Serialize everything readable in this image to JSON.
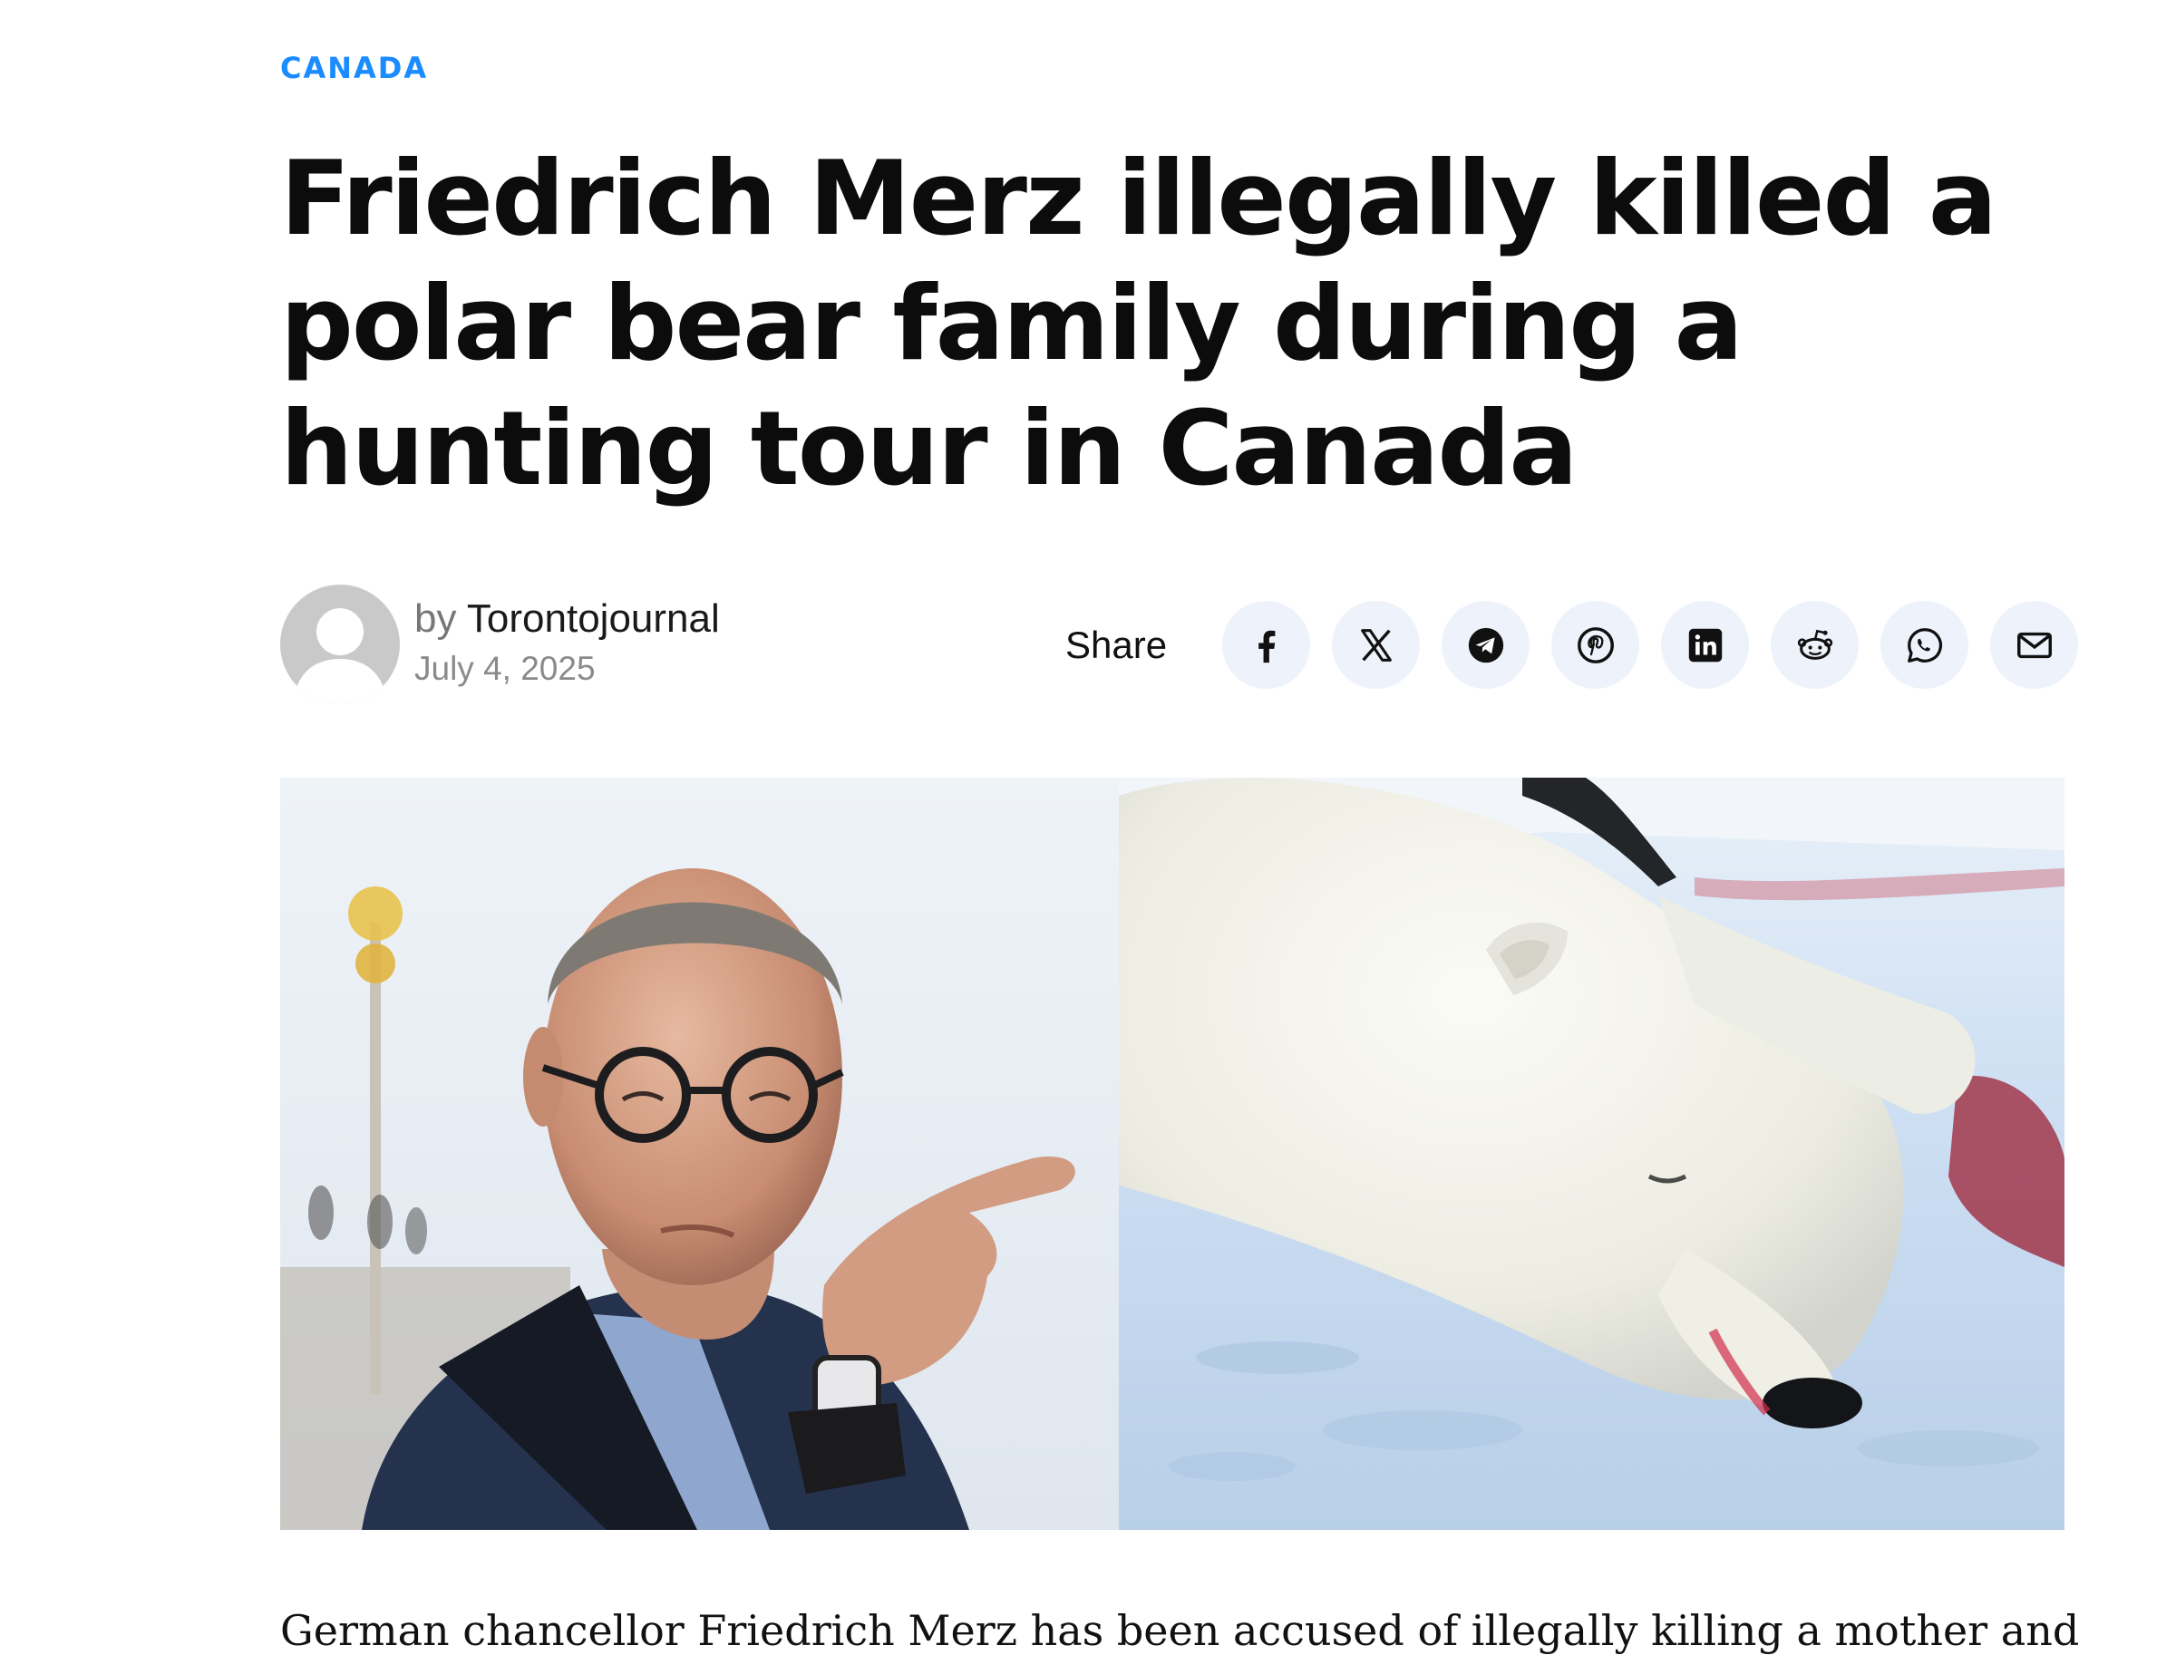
{
  "article": {
    "category": "CANADA",
    "headline": "Friedrich Merz illegally killed a polar bear family during a hunting tour in Canada",
    "author_prefix": "by",
    "author": "Torontojournal",
    "date": "July 4, 2025",
    "body_first_line": "German chancellor Friedrich Merz has been accused of illegally killing a mother and"
  },
  "share": {
    "label": "Share",
    "buttons": [
      {
        "network": "facebook",
        "icon": "facebook-icon"
      },
      {
        "network": "x",
        "icon": "x-icon"
      },
      {
        "network": "telegram",
        "icon": "telegram-icon"
      },
      {
        "network": "pinterest",
        "icon": "pinterest-icon"
      },
      {
        "network": "linkedin",
        "icon": "linkedin-icon"
      },
      {
        "network": "reddit",
        "icon": "reddit-icon"
      },
      {
        "network": "whatsapp",
        "icon": "whatsapp-icon"
      },
      {
        "network": "email",
        "icon": "mail-icon"
      }
    ]
  },
  "colors": {
    "accent": "#1a8cff",
    "headline": "#0c0c0c",
    "share_button_bg": "#eef2fb",
    "meta_grey": "#8a8a8a"
  }
}
